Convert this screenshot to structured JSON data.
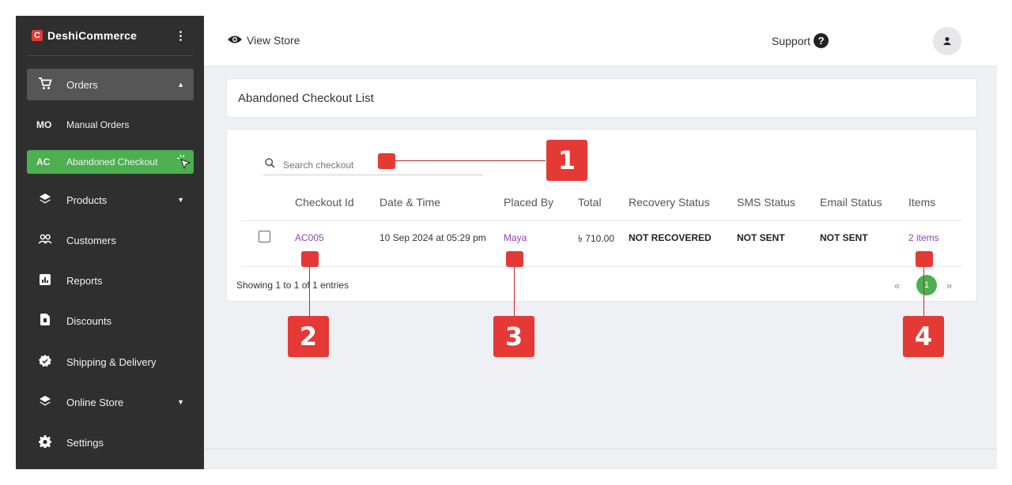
{
  "brand": {
    "logo_letter": "C",
    "name": "DeshiCommerce",
    "menu_glyph": "⋮"
  },
  "sidebar": {
    "orders": {
      "label": "Orders"
    },
    "sub_items": [
      {
        "abbr": "MO",
        "label": "Manual Orders"
      },
      {
        "abbr": "AC",
        "label": "Abandoned Checkout"
      }
    ],
    "items": [
      {
        "label": "Products",
        "icon": "layers-icon",
        "has_caret": true
      },
      {
        "label": "Customers",
        "icon": "users-icon",
        "has_caret": false
      },
      {
        "label": "Reports",
        "icon": "chart-icon",
        "has_caret": false
      },
      {
        "label": "Discounts",
        "icon": "file-icon",
        "has_caret": false
      },
      {
        "label": "Shipping & Delivery",
        "icon": "badge-check-icon",
        "has_caret": false
      },
      {
        "label": "Online Store",
        "icon": "layers-icon",
        "has_caret": true
      },
      {
        "label": "Settings",
        "icon": "gear-icon",
        "has_caret": false
      }
    ]
  },
  "topbar": {
    "view_store": "View Store",
    "support": "Support",
    "help_glyph": "?"
  },
  "page": {
    "title": "Abandoned Checkout List"
  },
  "search": {
    "placeholder": "Search checkout"
  },
  "table": {
    "headers": [
      "Checkout Id",
      "Date & Time",
      "Placed By",
      "Total",
      "Recovery Status",
      "SMS Status",
      "Email Status",
      "Items"
    ],
    "rows": [
      {
        "checkout_id": "AC005",
        "date_time": "10 Sep 2024 at 05:29 pm",
        "placed_by": "Maya",
        "total": "৳ 710.00",
        "recovery_status": "NOT RECOVERED",
        "sms_status": "NOT SENT",
        "email_status": "NOT SENT",
        "items": "2 items"
      }
    ]
  },
  "footer": {
    "showing": "Showing 1 to 1 of 1 entries",
    "prev": "«",
    "page": "1",
    "next": "»"
  },
  "callouts": [
    "1",
    "2",
    "3",
    "4"
  ],
  "colors": {
    "accent": "#4caf50",
    "callout": "#e53935",
    "link": "#8e44ad",
    "sidebar": "#2f2f2f"
  }
}
